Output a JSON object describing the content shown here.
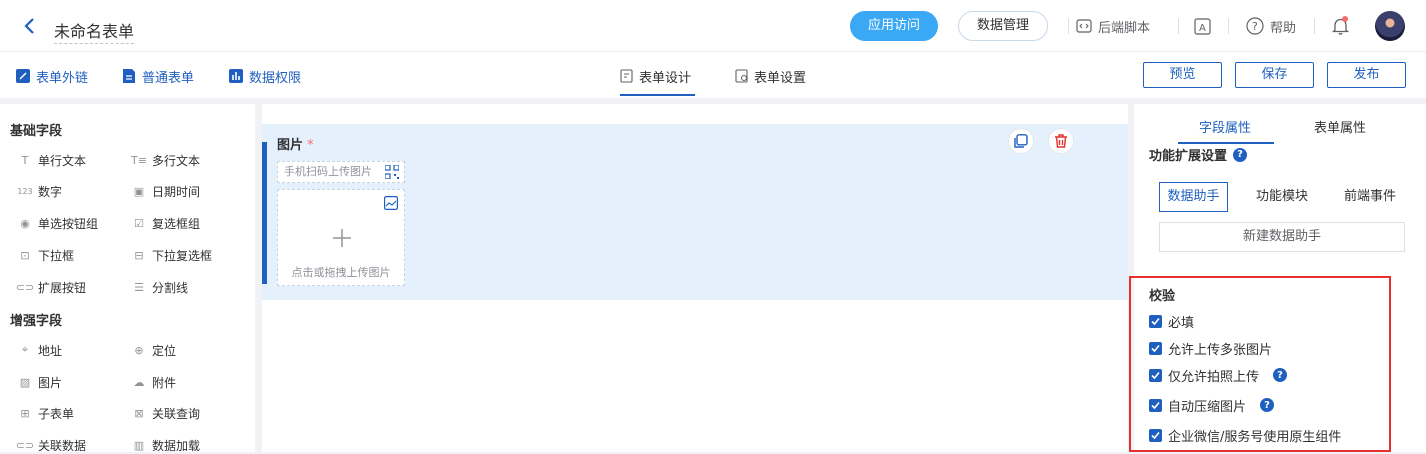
{
  "header": {
    "title": "未命名表单",
    "app_visit": "应用访问",
    "data_manage": "数据管理",
    "backend_script": "后端脚本",
    "help": "帮助"
  },
  "subbar": {
    "form_link": "表单外链",
    "normal_form": "普通表单",
    "data_permission": "数据权限",
    "tab_design": "表单设计",
    "tab_settings": "表单设置",
    "preview": "预览",
    "save": "保存",
    "publish": "发布"
  },
  "left": {
    "basic_title": "基础字段",
    "basic_fields": [
      "单行文本",
      "多行文本",
      "数字",
      "日期时间",
      "单选按钮组",
      "复选框组",
      "下拉框",
      "下拉复选框",
      "扩展按钮",
      "分割线"
    ],
    "enhanced_title": "增强字段",
    "enhanced_fields": [
      "地址",
      "定位",
      "图片",
      "附件",
      "子表单",
      "关联查询",
      "关联数据",
      "数据加载"
    ]
  },
  "canvas": {
    "field_label": "图片",
    "required_mark": "*",
    "scan_text": "手机扫码上传图片",
    "upload_text": "点击或拖拽上传图片"
  },
  "right": {
    "tab_field": "字段属性",
    "tab_form": "表单属性",
    "ext_title": "功能扩展设置",
    "options": [
      "数据助手",
      "功能模块",
      "前端事件"
    ],
    "new_helper": "新建数据助手",
    "validate_title": "校验",
    "checks": [
      "必填",
      "允许上传多张图片",
      "仅允许拍照上传",
      "自动压缩图片",
      "企业微信/服务号使用原生组件"
    ]
  },
  "colors": {
    "primary": "#1f5fbf",
    "accent_button": "#3aa8f5",
    "selection_bg": "#e4f1fd",
    "highlight_box": "#e5302f"
  }
}
